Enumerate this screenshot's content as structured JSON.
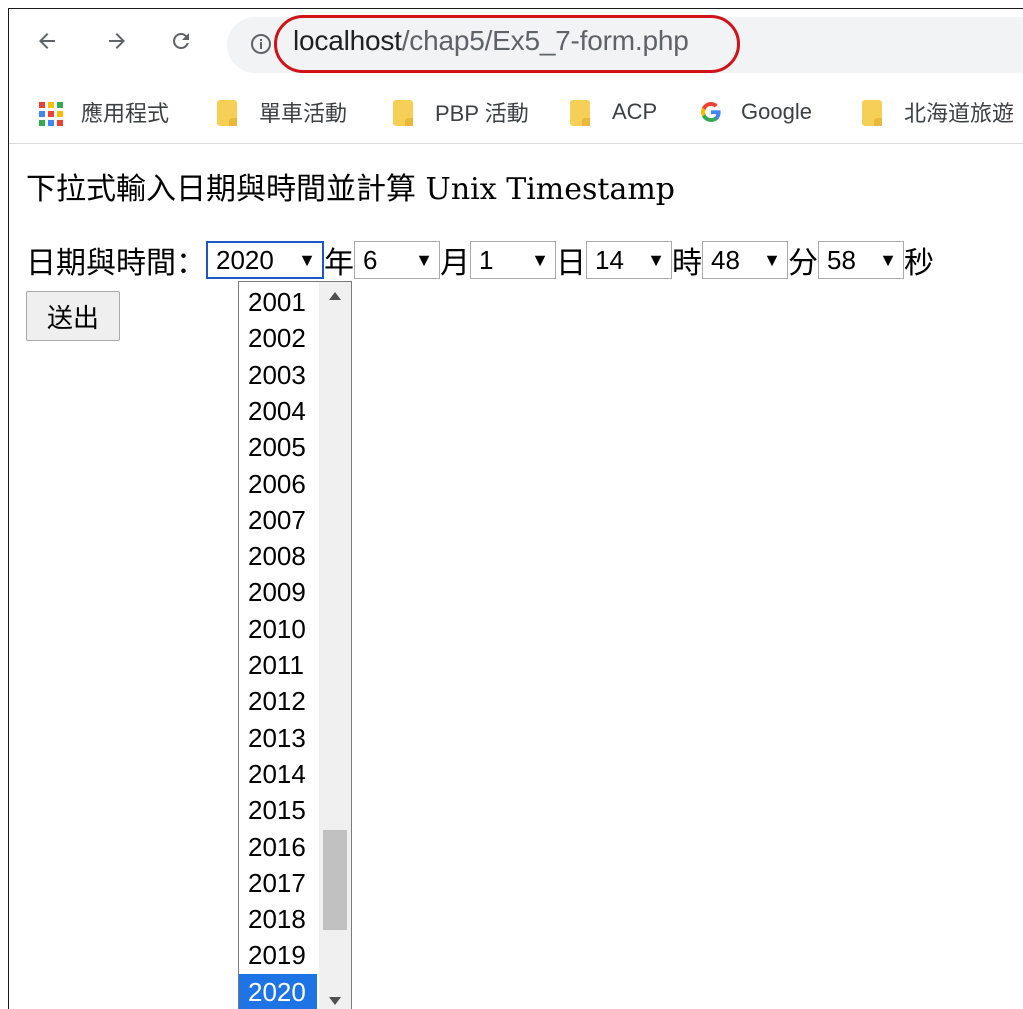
{
  "browser": {
    "url_host": "localhost",
    "url_path": "/chap5/Ex5_7-form.php",
    "annotation_color": "#d0121b"
  },
  "bookmarks": [
    {
      "label": "應用程式",
      "icon": "apps-grid-icon"
    },
    {
      "label": "單車活動",
      "icon": "folder-icon"
    },
    {
      "label": "PBP 活動",
      "icon": "folder-icon"
    },
    {
      "label": "ACP",
      "icon": "folder-icon"
    },
    {
      "label": "Google",
      "icon": "google-g-icon"
    },
    {
      "label": "北海道旅遊",
      "icon": "folder-icon"
    }
  ],
  "page": {
    "heading": "下拉式輸入日期與時間並計算 Unix Timestamp",
    "form_label": "日期與時間：",
    "selects": {
      "year": "2020",
      "month": "6",
      "day": "1",
      "hour": "14",
      "minute": "48",
      "second": "58"
    },
    "units": {
      "year": "年",
      "month": "月",
      "day": "日",
      "hour": "時",
      "minute": "分",
      "second": "秒"
    },
    "submit_label": "送出"
  },
  "year_dropdown": {
    "options": [
      "2001",
      "2002",
      "2003",
      "2004",
      "2005",
      "2006",
      "2007",
      "2008",
      "2009",
      "2010",
      "2011",
      "2012",
      "2013",
      "2014",
      "2015",
      "2016",
      "2017",
      "2018",
      "2019",
      "2020"
    ],
    "selected": "2020",
    "highlight_color": "#1e74e5"
  }
}
